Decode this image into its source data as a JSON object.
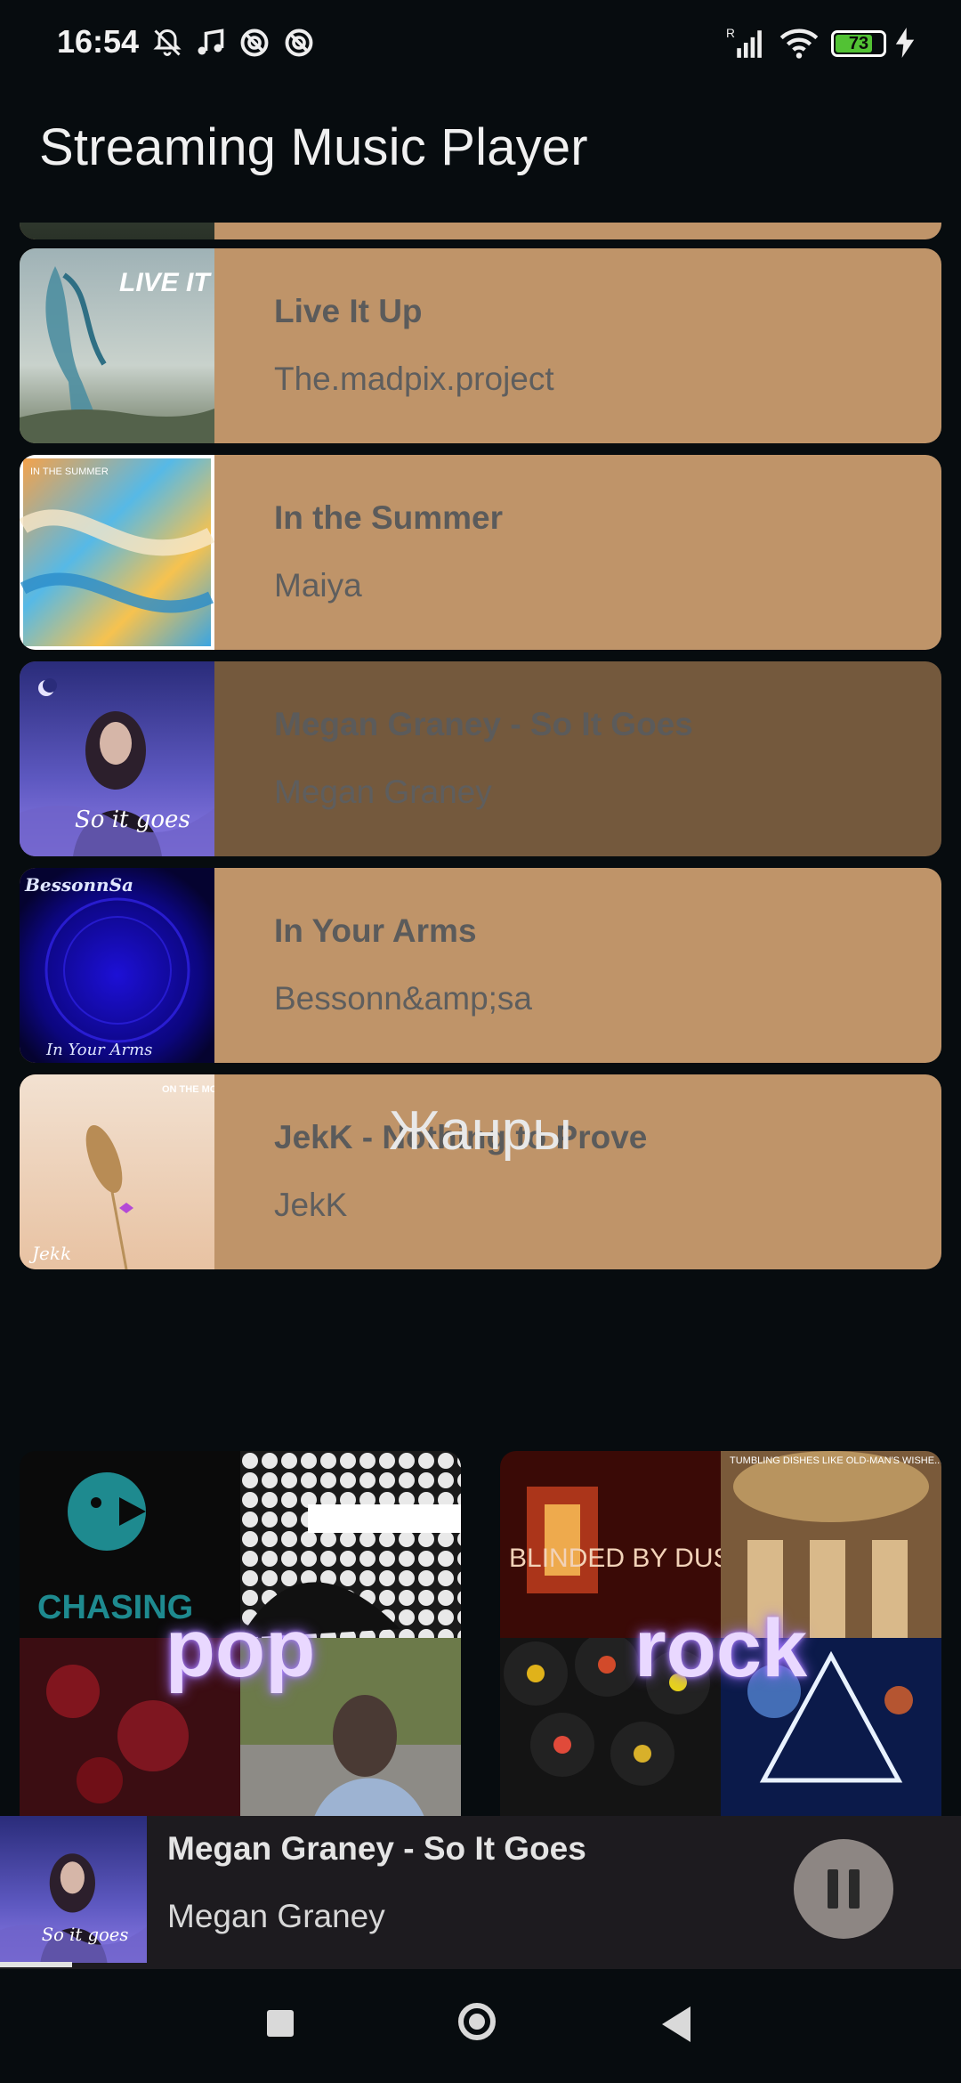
{
  "status_bar": {
    "time": "16:54",
    "icons": [
      "bell-off-icon",
      "music-note-icon",
      "no-entry-icon",
      "no-entry-icon",
      "signal-icon",
      "wifi-icon",
      "battery-icon",
      "charging-icon"
    ],
    "battery_level": "73",
    "signal_label": "R"
  },
  "app_bar": {
    "title": "Streaming Music Player"
  },
  "tracks": [
    {
      "title": "Live It Up",
      "artist": "The.madpix.project",
      "art_text": "LIVE IT UP"
    },
    {
      "title": "In the Summer",
      "artist": "Maiya",
      "art_text": "IN THE SUMMER"
    },
    {
      "title": "Megan Graney - So It Goes",
      "artist": "Megan Graney",
      "art_text": "So it goes",
      "selected": true
    },
    {
      "title": "In Your Arms",
      "artist": "Bessonn&amp;sa",
      "art_text": "In Your Arms"
    },
    {
      "title": "JekK - Nothing to Prove",
      "artist": "JekK",
      "art_text": "ON THE MOON"
    }
  ],
  "genres_section": {
    "title": "Жанры"
  },
  "genres": [
    {
      "name": "pop"
    },
    {
      "name": "rock"
    }
  ],
  "now_playing": {
    "title": "Megan Graney - So It Goes",
    "artist": "Megan Graney",
    "state": "playing",
    "progress": 0.075
  },
  "colors": {
    "background": "#070c0f",
    "card": "#bf9469",
    "card_selected": "#74593d",
    "player_bar": "#1d1b1f",
    "pause_button": "#8d8683"
  }
}
